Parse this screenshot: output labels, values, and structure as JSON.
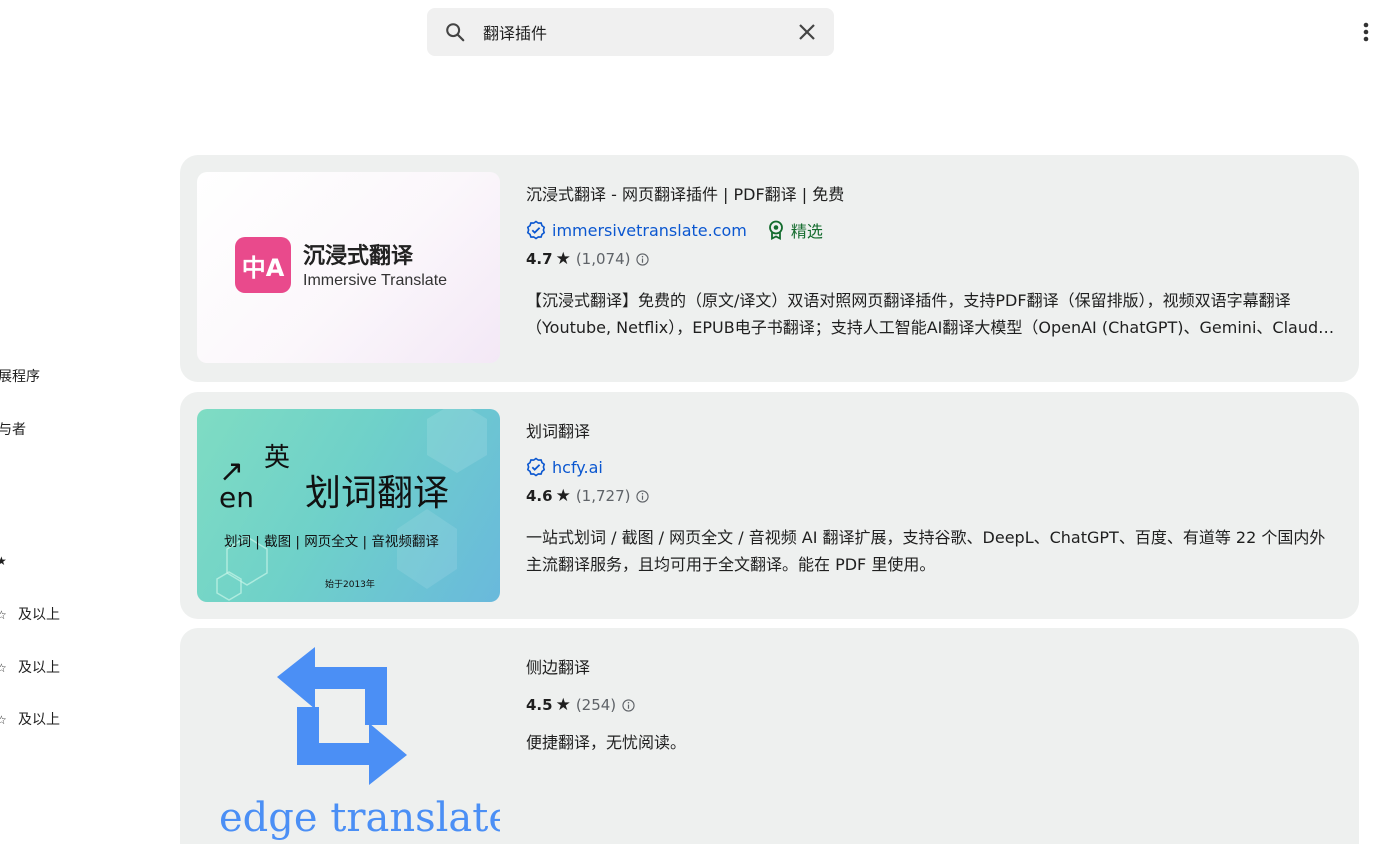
{
  "search": {
    "value": "翻译插件"
  },
  "sidebar": {
    "items": [
      "展程序",
      "与者"
    ],
    "rating_suffix": [
      "及以上",
      "及以上",
      "及以上"
    ]
  },
  "results": [
    {
      "title": "沉浸式翻译 - 网页翻译插件 | PDF翻译 | 免费",
      "publisher": "immersivetranslate.com",
      "badge": "精选",
      "rating": "4.7",
      "count": "(1,074)",
      "description": "【沉浸式翻译】免费的（原文/译文）双语对照网页翻译插件，支持PDF翻译（保留排版），视频双语字幕翻译（Youtube, Netflix），EPUB电子书翻译；支持人工智能AI翻译大模型（OpenAI (ChatGPT)、Gemini、Claude 等）",
      "thumb": {
        "logo_cn": "沉浸式翻译",
        "logo_en": "Immersive Translate",
        "icon_text": "中A"
      }
    },
    {
      "title": "划词翻译",
      "publisher": "hcfy.ai",
      "rating": "4.6",
      "count": "(1,727)",
      "description": "一站式划词 / 截图 / 网页全文 / 音视频 AI 翻译扩展，支持谷歌、DeepL、ChatGPT、百度、有道等 22 个国内外主流翻译服务，且均可用于全文翻译。能在 PDF 里使用。",
      "thumb": {
        "big": "划词翻译",
        "cn": "英",
        "en": "en",
        "sub": "划词 | 截图 | 网页全文 | 音视频翻译",
        "since": "始于2013年"
      }
    },
    {
      "title": "侧边翻译",
      "rating": "4.5",
      "count": "(254)",
      "description": "便捷翻译，无忧阅读。",
      "thumb": {
        "text": "edge translate"
      }
    }
  ],
  "colors": {
    "card_bg": "#eef0ef",
    "link": "#0b57d0",
    "featured": "#146c2e",
    "accent_pink": "#e94a8c",
    "edge_blue": "#4b8ff5"
  }
}
